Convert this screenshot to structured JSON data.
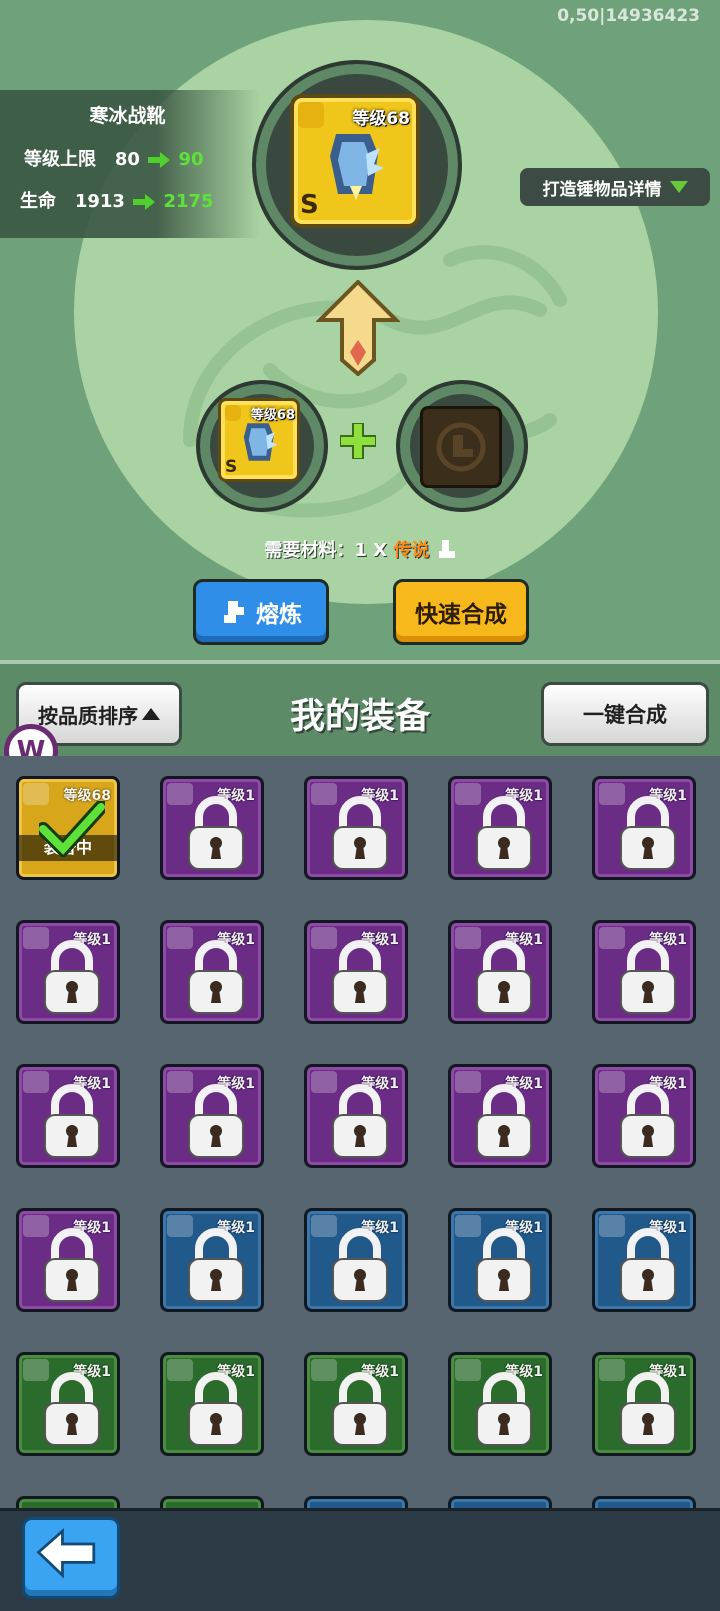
{
  "build_id": "0,50|14936423",
  "info": {
    "item_name": "寒冰战靴",
    "level_cap_label": "等级上限",
    "level_cap_from": "80",
    "level_cap_to": "90",
    "hp_label": "生命",
    "hp_from": "1913",
    "hp_to": "2175"
  },
  "details_button": "打造锤物品详情",
  "main_item": {
    "level": "等级68",
    "rank": "S"
  },
  "ingredient_item": {
    "level": "等级68",
    "rank": "S"
  },
  "need": {
    "prefix": "需要材料：1 X ",
    "quality": "传说"
  },
  "buttons": {
    "smelt": "熔炼",
    "quick": "快速合成",
    "sort": "按品质排序",
    "one_key": "一键合成"
  },
  "equip_title": "我的装备",
  "logo_letter": "W",
  "equipped_label": "装备中",
  "grid": [
    {
      "color": "gold",
      "level": "等级68",
      "equipped": true
    },
    {
      "color": "purple",
      "level": "等级1"
    },
    {
      "color": "purple",
      "level": "等级1"
    },
    {
      "color": "purple",
      "level": "等级1"
    },
    {
      "color": "purple",
      "level": "等级1"
    },
    {
      "color": "purple",
      "level": "等级1"
    },
    {
      "color": "purple",
      "level": "等级1"
    },
    {
      "color": "purple",
      "level": "等级1"
    },
    {
      "color": "purple",
      "level": "等级1"
    },
    {
      "color": "purple",
      "level": "等级1"
    },
    {
      "color": "purple",
      "level": "等级1"
    },
    {
      "color": "purple",
      "level": "等级1"
    },
    {
      "color": "purple",
      "level": "等级1"
    },
    {
      "color": "purple",
      "level": "等级1"
    },
    {
      "color": "purple",
      "level": "等级1"
    },
    {
      "color": "purple",
      "level": "等级1"
    },
    {
      "color": "blue",
      "level": "等级1"
    },
    {
      "color": "blue",
      "level": "等级1"
    },
    {
      "color": "blue",
      "level": "等级1"
    },
    {
      "color": "blue",
      "level": "等级1"
    },
    {
      "color": "green",
      "level": "等级1"
    },
    {
      "color": "green",
      "level": "等级1"
    },
    {
      "color": "green",
      "level": "等级1"
    },
    {
      "color": "green",
      "level": "等级1"
    },
    {
      "color": "green",
      "level": "等级1"
    }
  ]
}
